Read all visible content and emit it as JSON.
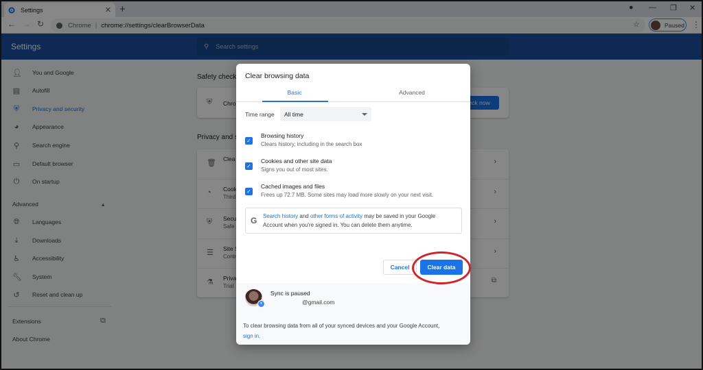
{
  "browser": {
    "tab_title": "Settings",
    "site_name": "Chrome",
    "url": "chrome://settings/clearBrowserData",
    "profile_label": "Paused"
  },
  "settings": {
    "title": "Settings",
    "search_placeholder": "Search settings",
    "sidebar": {
      "items": [
        {
          "label": "You and Google",
          "icon": "person-icon"
        },
        {
          "label": "Autofill",
          "icon": "clipboard-icon"
        },
        {
          "label": "Privacy and security",
          "icon": "shield-icon"
        },
        {
          "label": "Appearance",
          "icon": "palette-icon"
        },
        {
          "label": "Search engine",
          "icon": "search-icon"
        },
        {
          "label": "Default browser",
          "icon": "browser-icon"
        },
        {
          "label": "On startup",
          "icon": "power-icon"
        }
      ],
      "advanced_heading": "Advanced",
      "advanced_items": [
        {
          "label": "Languages",
          "icon": "globe-icon"
        },
        {
          "label": "Downloads",
          "icon": "download-icon"
        },
        {
          "label": "Accessibility",
          "icon": "accessibility-icon"
        },
        {
          "label": "System",
          "icon": "wrench-icon"
        },
        {
          "label": "Reset and clean up",
          "icon": "restore-icon"
        }
      ],
      "extensions": "Extensions",
      "about": "About Chrome"
    },
    "main": {
      "safety_check_heading": "Safety check",
      "safety_row_title": "Chro",
      "check_now_label": "eck now",
      "privacy_heading": "Privacy and s",
      "rows": [
        {
          "title": "Clea",
          "sub": ""
        },
        {
          "title": "Cook",
          "sub": "Third"
        },
        {
          "title": "Secu",
          "sub": "Safe"
        },
        {
          "title": "Site S",
          "sub": "Contr"
        },
        {
          "title": "Priva",
          "sub": "Trial"
        }
      ]
    }
  },
  "dialog": {
    "title": "Clear browsing data",
    "tabs": [
      "Basic",
      "Advanced"
    ],
    "time_range_label": "Time range",
    "time_range_value": "All time",
    "options": [
      {
        "title": "Browsing history",
        "sub": "Clears history, including in the search box",
        "checked": true
      },
      {
        "title": "Cookies and other site data",
        "sub": "Signs you out of most sites.",
        "checked": true
      },
      {
        "title": "Cached images and files",
        "sub": "Frees up 72.7 MB. Some sites may load more slowly on your next visit.",
        "checked": true
      }
    ],
    "google_note": {
      "link1": "Search history",
      "and": " and ",
      "link2": "other forms of activity",
      "rest1": " may be saved in your Google",
      "line2": "Account when you're signed in. You can delete them anytime."
    },
    "cancel_label": "Cancel",
    "clear_label": "Clear data",
    "sync": {
      "status": "Sync is paused",
      "email": "@gmail.com",
      "footer_text": "To clear browsing data from all of your synced devices and your Google Account,",
      "signin_link": "sign in."
    }
  },
  "colors": {
    "accent": "#1a73e8",
    "header": "#1a4f9f",
    "highlight": "#d3232a"
  }
}
